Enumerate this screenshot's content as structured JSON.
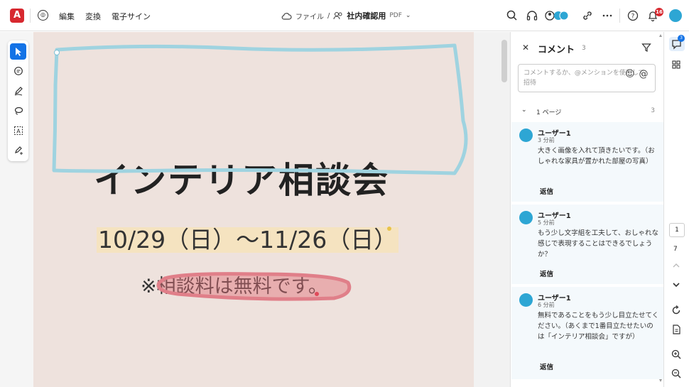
{
  "app": {
    "logo_glyph": "A",
    "menu": [
      {
        "label": "編集"
      },
      {
        "label": "変換"
      },
      {
        "label": "電子サイン"
      }
    ],
    "breadcrumb": {
      "root": "ファイル",
      "separator": "/",
      "document": "社内確認用",
      "ext": "PDF"
    },
    "notifications_count": "16",
    "accent": "#1473e6",
    "brand": "#d7282f"
  },
  "toolbar_icons": [
    "cloud-icon",
    "search-icon",
    "headset-icon",
    "share-people-icon",
    "link-icon",
    "more-icon",
    "help-icon",
    "bell-icon"
  ],
  "tools": [
    {
      "name": "select-tool",
      "active": true
    },
    {
      "name": "comment-tool",
      "active": false
    },
    {
      "name": "draw-tool",
      "active": false
    },
    {
      "name": "lasso-tool",
      "active": false
    },
    {
      "name": "text-select-tool",
      "active": false
    },
    {
      "name": "sign-tool",
      "active": false
    }
  ],
  "page": {
    "title": "インテリア相談会",
    "dates": "10/29（日）～11/26（日）",
    "note": "※相談料は無料です。"
  },
  "comments_panel": {
    "title": "コメント",
    "count": "3",
    "input_placeholder": "コメントするか、@メンションを使用して招待",
    "group_label": "1 ページ",
    "group_count": "3",
    "reply_label": "返信",
    "items": [
      {
        "user": "ユーザー1",
        "time": "3 分前",
        "text": "大きく画像を入れて頂きたいです。（おしゃれな家具が置かれた部屋の写真）"
      },
      {
        "user": "ユーザー1",
        "time": "5 分前",
        "text": "もう少し文字組を工夫して、おしゃれな感じで表現することはできるでしょうか？"
      },
      {
        "user": "ユーザー1",
        "time": "6 分前",
        "text": "無料であることをもう少し目立たせてください。（あくまで1番目立たせたいのは「インテリア相談会」ですが）"
      }
    ]
  },
  "right_rail": {
    "comments_badge": "3",
    "current_page": "1",
    "total_pages": "7"
  }
}
